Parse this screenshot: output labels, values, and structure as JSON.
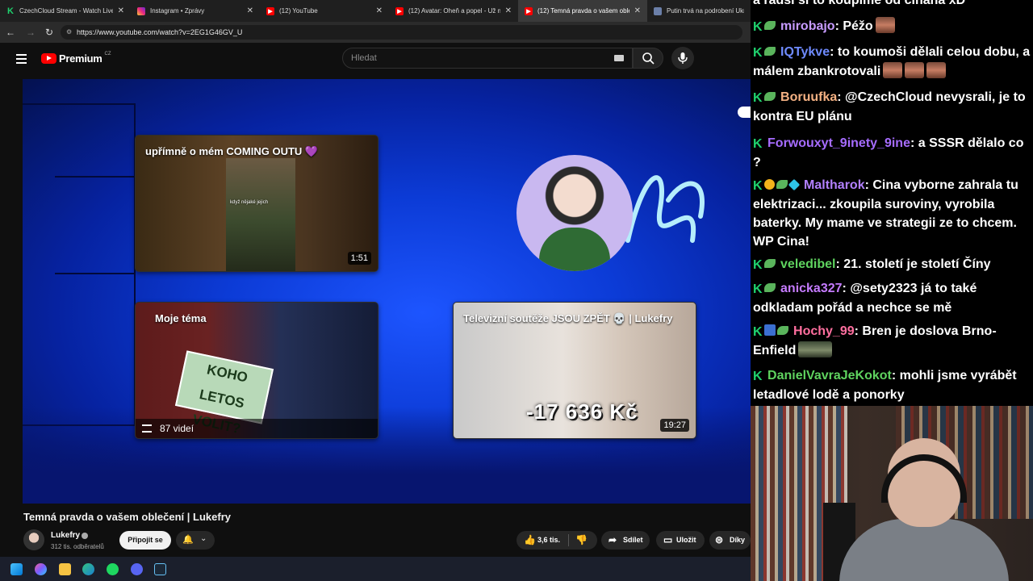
{
  "browser": {
    "tabs": [
      {
        "title": "CzechCloud Stream - Watch Live o",
        "favicon": "K",
        "favicon_color": "#1fd26e",
        "active": false
      },
      {
        "title": "Instagram • Zprávy",
        "favicon": "instagram-icon",
        "favicon_color": "#d6249f",
        "active": false
      },
      {
        "title": "(12) YouTube",
        "favicon": "youtube-icon",
        "favicon_color": "#ff0000",
        "active": false
      },
      {
        "title": "(12) Avatar: Oheň a popel - Už mé",
        "favicon": "youtube-icon",
        "favicon_color": "#ff0000",
        "active": false
      },
      {
        "title": "(12) Temná pravda o vašem oblečen",
        "favicon": "youtube-icon",
        "favicon_color": "#ff0000",
        "active": true
      },
      {
        "title": "Putin trvá na podrobení Ukraji",
        "favicon": "page-icon",
        "favicon_color": "#6b7fa8",
        "active": false
      }
    ],
    "url": "https://www.youtube.com/watch?v=2EG1G46GV_U"
  },
  "youtube": {
    "logo_text": "Premium",
    "logo_region": "CZ",
    "search_placeholder": "Hledat",
    "end_cards": [
      {
        "title": "upřímně o mém COMING OUTU 💜",
        "duration": "1:51",
        "subtitle": "když nějaké jejich"
      },
      {
        "title": "Moje téma",
        "playlist_count": "87 videí",
        "sign_text": "KOHO LETOS VOLIT?"
      },
      {
        "title": "Televizní soutěže JSOU ZPĚT 💀 | Lukefry",
        "duration": "19:27",
        "overlay_text": "-17 636 Kč"
      }
    ],
    "video_title": "Temná pravda o vašem oblečení | Lukefry",
    "channel_name": "Lukefry",
    "subscribers": "312 tis. odběratelů",
    "join_label": "Připojit se",
    "like_count": "3,6 tis.",
    "share_label": "Sdílet",
    "save_label": "Uložit",
    "thanks_label": "Díky"
  },
  "chat": {
    "top_partial": "a radši si to koupíme od čínana xD",
    "messages": [
      {
        "user": "mirobajo",
        "color": "#c79bff",
        "badges": [
          "k",
          "leaf"
        ],
        "text": "Péžo",
        "emotes": 1
      },
      {
        "user": "IQTykve",
        "color": "#6f8bff",
        "badges": [
          "k",
          "leaf"
        ],
        "text": "to koumoši dělali celou dobu, a málem zbankrotovali",
        "emotes": 3
      },
      {
        "user": "Boruufka",
        "color": "#f4b183",
        "badges": [
          "k",
          "leaf"
        ],
        "text": "@CzechCloud nevysrali, je to kontra EU plánu",
        "emotes": 0
      },
      {
        "user": "Forwouxyt_9inety_9ine",
        "color": "#a66cff",
        "badges": [
          "k"
        ],
        "text": "a SSSR dělalo co ?",
        "emotes": 0
      },
      {
        "user": "Maltharok",
        "color": "#b280ff",
        "badges": [
          "k",
          "coin",
          "leaf",
          "cube"
        ],
        "text": "Cina vyborne zahrala tu elektrizaci... zkoupila suroviny, vyrobila baterky. My mame ve strategii ze to chcem. WP Cina!",
        "emotes": 0
      },
      {
        "user": "veledibel",
        "color": "#5fd35f",
        "badges": [
          "k",
          "leaf"
        ],
        "text": "21. století je století Číny",
        "emotes": 0
      },
      {
        "user": "anicka327",
        "color": "#c57bff",
        "badges": [
          "k",
          "leaf"
        ],
        "text": "@sety2323 já to také odkladam pořád a nechce se mě",
        "emotes": 0
      },
      {
        "user": "Hochy_99",
        "color": "#ff6f9f",
        "badges": [
          "k",
          "blue",
          "leaf"
        ],
        "text": "Bren je doslova Brno-Enfield",
        "emotes": 1
      },
      {
        "user": "DanielVavraJeKokot",
        "color": "#5fd35f",
        "badges": [
          "k"
        ],
        "text": "mohli jsme vyrábět letadlové lodě a ponorky",
        "emotes": 0
      }
    ]
  },
  "colors": {
    "accent": "#ff0000",
    "kick_green": "#1fd26e",
    "player_blue": "#0c3bd6"
  }
}
